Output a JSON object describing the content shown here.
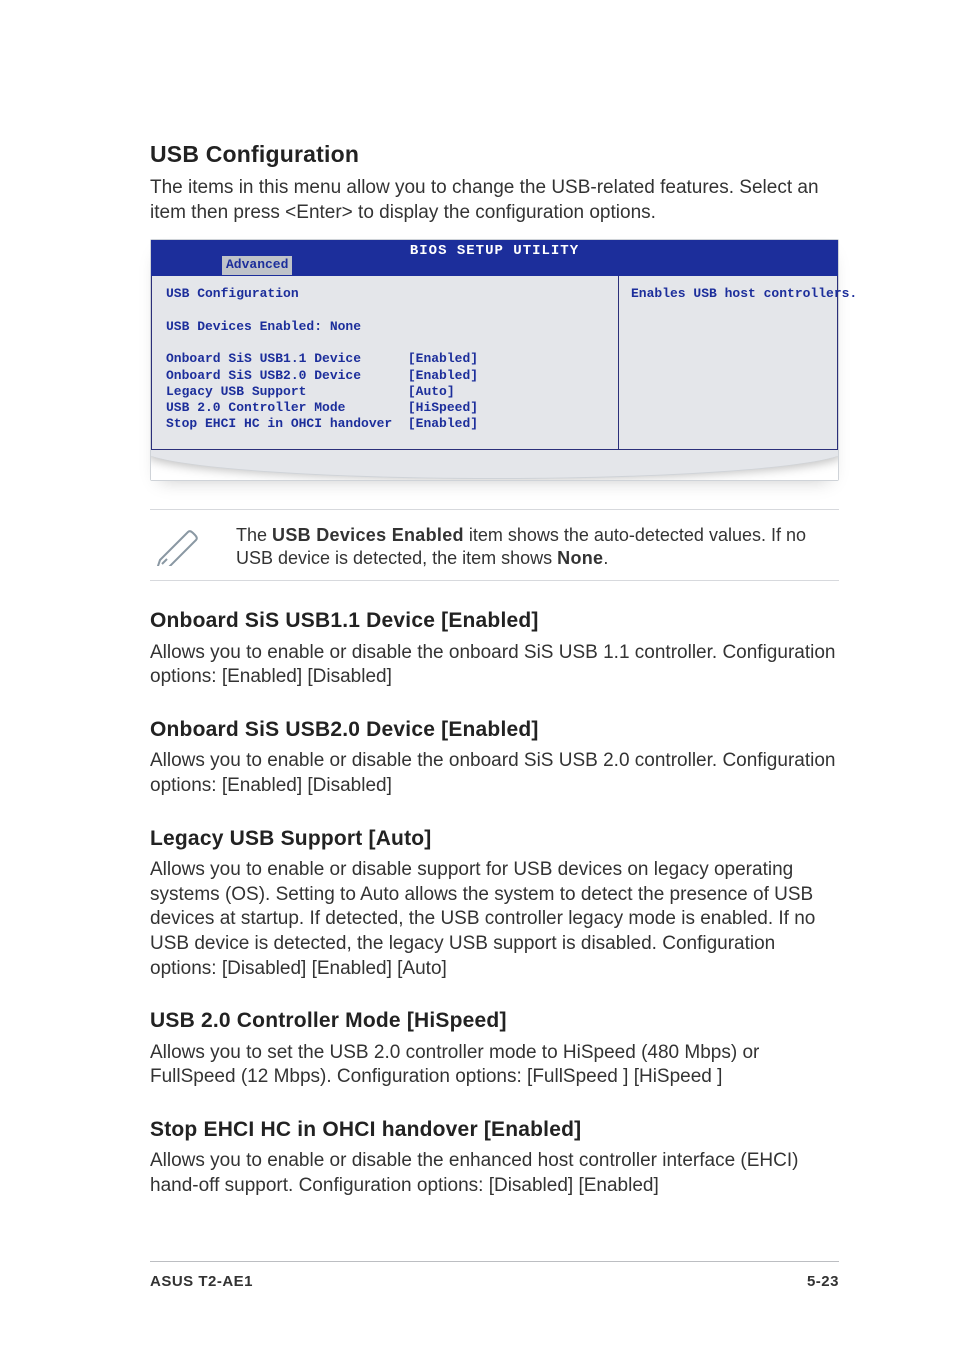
{
  "page": {
    "title": "USB Configuration",
    "intro": "The items in this menu allow you to change the USB-related features. Select an item then press <Enter> to display the configuration options."
  },
  "bios": {
    "title": "BIOS SETUP UTILITY",
    "tab": "Advanced",
    "help": "Enables USB host controllers.",
    "heading": "USB Configuration",
    "devices_line": "USB Devices Enabled: None",
    "items": [
      {
        "label": "Onboard SiS USB1.1 Device",
        "value": "[Enabled]"
      },
      {
        "label": "Onboard SiS USB2.0 Device",
        "value": "[Enabled]"
      },
      {
        "label": "Legacy USB Support",
        "value": "[Auto]"
      },
      {
        "label": "USB 2.0 Controller Mode",
        "value": "[HiSpeed]"
      },
      {
        "label": "Stop EHCI HC in OHCI handover",
        "value": "[Enabled]"
      }
    ]
  },
  "note": {
    "prefix": "The ",
    "bold1": "USB Devices Enabled",
    "mid": " item shows the auto-detected values. If no USB device is detected, the item shows ",
    "bold2": "None",
    "suffix": "."
  },
  "sections": [
    {
      "title": "Onboard SiS USB1.1 Device [Enabled]",
      "body": "Allows you to enable or disable the onboard SiS USB 1.1 controller. Configuration options: [Enabled] [Disabled]"
    },
    {
      "title": "Onboard SiS USB2.0 Device [Enabled]",
      "body": "Allows you to enable or disable the onboard SiS USB 2.0 controller. Configuration options: [Enabled] [Disabled]"
    },
    {
      "title": "Legacy USB Support [Auto]",
      "body": "Allows you to enable or disable support for USB devices on legacy operating systems (OS). Setting to Auto allows the system to detect the presence of USB devices at startup. If detected, the USB controller legacy mode is enabled. If no USB device is detected, the legacy USB support is disabled. Configuration options: [Disabled] [Enabled] [Auto]"
    },
    {
      "title": "USB 2.0 Controller Mode [HiSpeed]",
      "body": "Allows you to set the USB 2.0 controller mode to HiSpeed (480 Mbps) or FullSpeed (12 Mbps). Configuration options: [FullSpeed ] [HiSpeed ]"
    },
    {
      "title": "Stop EHCI HC in OHCI handover [Enabled]",
      "body": "Allows you to enable or disable the enhanced host controller interface (EHCI) hand-off support. Configuration options: [Disabled] [Enabled]"
    }
  ],
  "footer": {
    "left": "ASUS T2-AE1",
    "right": "5-23"
  }
}
